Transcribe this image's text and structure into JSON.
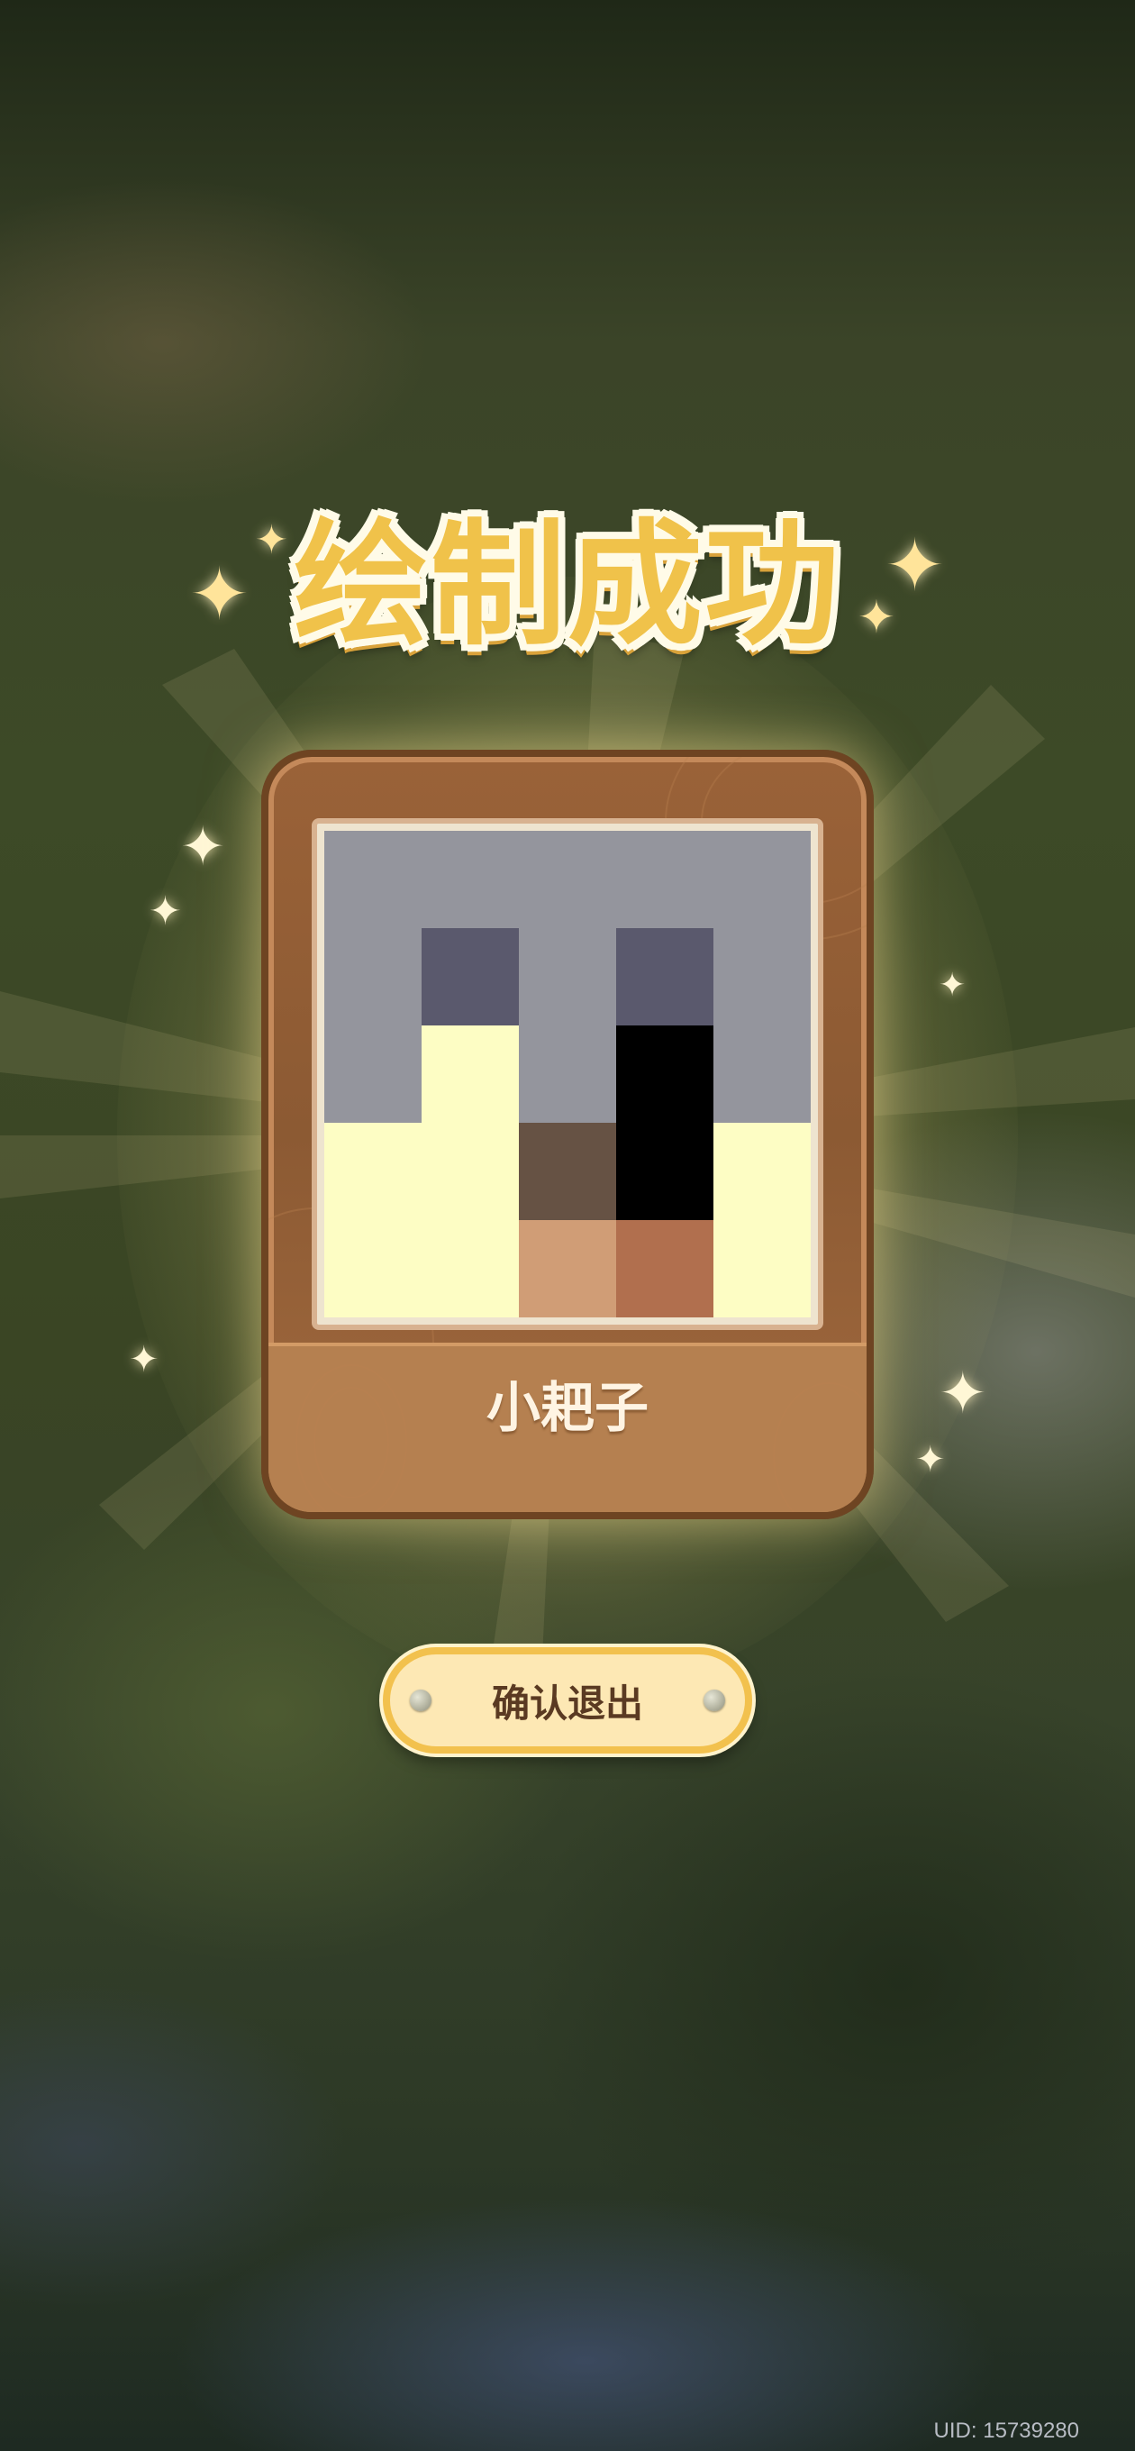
{
  "screen": {
    "title": "绘制成功",
    "artwork": {
      "name": "小耙子",
      "pixel_rows": [
        [
          "#94959d",
          "#94959d",
          "#94959d",
          "#94959d",
          "#94959d"
        ],
        [
          "#94959d",
          "#5a596d",
          "#94959d",
          "#5a596d",
          "#94959d"
        ],
        [
          "#94959d",
          "#fdfdc4",
          "#94959d",
          "#000000",
          "#94959d"
        ],
        [
          "#fdfdc4",
          "#fdfdc4",
          "#665244",
          "#000000",
          "#fdfdc4"
        ],
        [
          "#fdfdc4",
          "#fdfdc4",
          "#d09d76",
          "#b16f4e",
          "#fdfdc4"
        ]
      ]
    },
    "confirm_button": {
      "label": "确认退出"
    },
    "uid": "UID: 15739280"
  },
  "colors": {
    "title_fill": "#f0c24a",
    "card_wood": "#8c5a33",
    "button_fill": "#fde8b4",
    "button_border": "#f2c14e"
  },
  "icons": {
    "sparkle": "four-point-star",
    "rivet": "metal-rivet"
  }
}
